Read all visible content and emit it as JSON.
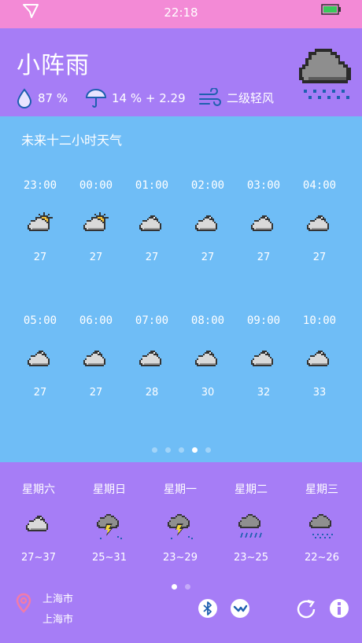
{
  "status": {
    "time": "22:18"
  },
  "current": {
    "condition": "小阵雨",
    "humidity": "87 %",
    "precip": "14 % + 2.29",
    "wind": "二级轻风"
  },
  "hourly": {
    "title": "未来十二小时天气",
    "items": [
      {
        "time": "23:00",
        "icon": "partly-sunny-icon",
        "temp": "27"
      },
      {
        "time": "00:00",
        "icon": "partly-sunny-icon",
        "temp": "27"
      },
      {
        "time": "01:00",
        "icon": "cloudy-icon",
        "temp": "27"
      },
      {
        "time": "02:00",
        "icon": "cloudy-icon",
        "temp": "27"
      },
      {
        "time": "03:00",
        "icon": "cloudy-icon",
        "temp": "27"
      },
      {
        "time": "04:00",
        "icon": "cloudy-icon",
        "temp": "27"
      },
      {
        "time": "05:00",
        "icon": "cloudy-icon",
        "temp": "27"
      },
      {
        "time": "06:00",
        "icon": "cloudy-icon",
        "temp": "27"
      },
      {
        "time": "07:00",
        "icon": "cloudy-icon",
        "temp": "28"
      },
      {
        "time": "08:00",
        "icon": "cloudy-icon",
        "temp": "30"
      },
      {
        "time": "09:00",
        "icon": "cloudy-icon",
        "temp": "32"
      },
      {
        "time": "10:00",
        "icon": "cloudy-icon",
        "temp": "33"
      }
    ]
  },
  "daily": {
    "items": [
      {
        "day": "星期六",
        "icon": "cloudy-icon",
        "range": "27~37"
      },
      {
        "day": "星期日",
        "icon": "thunderstorm-icon",
        "range": "25~31"
      },
      {
        "day": "星期一",
        "icon": "thunderstorm-icon",
        "range": "23~29"
      },
      {
        "day": "星期二",
        "icon": "rain-icon",
        "range": "23~25"
      },
      {
        "day": "星期三",
        "icon": "light-rain-icon",
        "range": "22~26"
      }
    ]
  },
  "location": {
    "line1": "上海市",
    "line2": "上海市"
  },
  "colors": {
    "status": "#f38ad6",
    "header": "#a67df6",
    "hourly": "#6fbdf6",
    "accent": "#1f5fb0"
  }
}
